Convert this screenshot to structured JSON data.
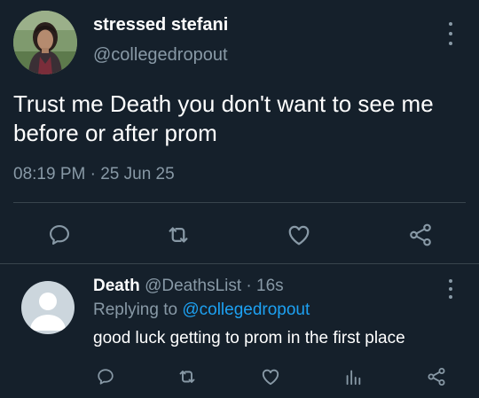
{
  "main_tweet": {
    "author_name": "stressed stefani",
    "author_handle": "@collegedropout",
    "text": "Trust me Death you don't want to see me before or after prom",
    "time": "08:19 PM",
    "separator": "·",
    "date": "25 Jun 25",
    "actions": [
      "reply-icon",
      "retweet-icon",
      "like-icon",
      "share-icon"
    ]
  },
  "reply_tweet": {
    "author_name": "Death",
    "author_handle": "@DeathsList",
    "separator": "·",
    "time_ago": "16s",
    "replying_to_label": "Replying to",
    "replying_to_handle": "@collegedropout",
    "text": "good luck getting to prom in the first place",
    "actions": [
      "reply-icon",
      "retweet-icon",
      "like-icon",
      "analytics-icon",
      "share-icon"
    ]
  },
  "colors": {
    "background": "#15202b",
    "primary_text": "#ffffff",
    "secondary_text": "#8899a6",
    "link": "#1da1f2",
    "divider": "#38444d",
    "default_avatar": "#ccd6dd"
  }
}
